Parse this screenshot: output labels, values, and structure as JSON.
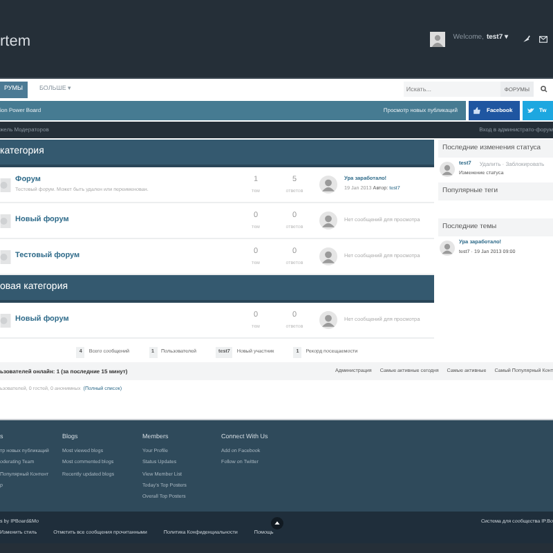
{
  "header": {
    "logo": "rtem",
    "welcome": "Welcome,",
    "user": "test7",
    "caret": "▾"
  },
  "nav": {
    "tabs": [
      {
        "label": "РУМЫ",
        "selected": true
      },
      {
        "label": "БОЛЬШЕ ▾",
        "selected": false
      }
    ],
    "search": {
      "placeholder": "Искать..."
    },
    "scope": "ФОРУМЫ"
  },
  "breadcrumb": {
    "path": "ion Power Board",
    "new_posts": "Просмотр новых публикаций",
    "social": [
      {
        "label": "Facebook",
        "kind": "facebook"
      },
      {
        "label": "Tw",
        "kind": "twitter"
      }
    ]
  },
  "subbar": {
    "left": "жель Модераторов",
    "right": "Вход в администрато-форум"
  },
  "categories": [
    {
      "title": "категория",
      "forums": [
        {
          "name": "Форум",
          "description": "Тестовый форум. Может быть удален или переименован.",
          "topics": "1",
          "topics_label": "тем",
          "replies": "5",
          "replies_label": "ответов",
          "last_post": {
            "title": "Ура заработало!",
            "date": "19 Jan 2013",
            "author_label": "Автор:",
            "author": "test7"
          }
        },
        {
          "name": "Новый форум",
          "topics": "0",
          "topics_label": "тем",
          "replies": "0",
          "replies_label": "ответов",
          "empty": "Нет сообщений для просмотра"
        },
        {
          "name": "Тестовый форум",
          "topics": "0",
          "topics_label": "тем",
          "replies": "0",
          "replies_label": "ответов",
          "empty": "Нет сообщений для просмотра"
        }
      ]
    },
    {
      "title": "овая категория",
      "forums": [
        {
          "name": "Новый форум",
          "topics": "0",
          "topics_label": "тем",
          "replies": "0",
          "replies_label": "ответов",
          "empty": "Нет сообщений для просмотра"
        }
      ]
    }
  ],
  "stats": [
    {
      "value": "4",
      "label": "Всего сообщений"
    },
    {
      "value": "1",
      "label": "Пользователей"
    },
    {
      "value": "test7",
      "label": "Новый участник"
    },
    {
      "value": "1",
      "label": "Рекорд посещаемости"
    }
  ],
  "online": {
    "title": "ьзователей онлайн: 1 (за последние 15 минут)",
    "links": [
      "Администрация",
      "Самые активные сегодня",
      "Самые активные",
      "Самый Популярный Конт"
    ],
    "summary": "ьзователей, 0 гостей, 0 анонимных",
    "full_list": "(Полный список)"
  },
  "sidebar": [
    {
      "title": "Последние изменения статуса",
      "items": [
        {
          "title": "test7",
          "line": "Изменение статуса",
          "actions": "Удалить · Заблокировать"
        }
      ]
    },
    {
      "title": "Популярные теги"
    },
    {
      "title": "Последние темы",
      "items": [
        {
          "title": "Ура заработало!",
          "line": "test7 · 19 Jan 2013 09:00"
        }
      ]
    }
  ],
  "footer": {
    "columns": [
      {
        "title": "s",
        "links": [
          "тр новых публикаций",
          "oderating Team",
          "Популярный Контент",
          "p"
        ]
      },
      {
        "title": "Blogs",
        "links": [
          "Most viewed blogs",
          "Most commented blogs",
          "Recently updated blogs"
        ]
      },
      {
        "title": "Members",
        "links": [
          "Your Profile",
          "Status Updates",
          "View Member List",
          "Today's Top Posters",
          "Overall Top Posters"
        ]
      },
      {
        "title": "Connect With Us",
        "links": [
          "Add on Facebook",
          "Follow on Twitter"
        ]
      }
    ],
    "powered": "s by IPBoard&Mo",
    "links": [
      "Изменить стиль",
      "Отметить все сообщения прочитанными",
      "Политика Конфиденциальности",
      "Помощь"
    ],
    "right": "Система для сообщества IP.Bo"
  }
}
